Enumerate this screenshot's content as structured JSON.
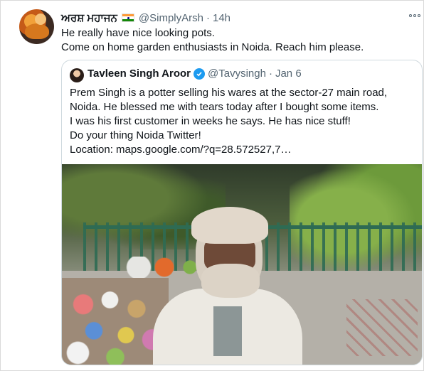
{
  "tweet": {
    "display_name": "ਅਰਸ਼ ਮਹਾਜਨ",
    "flag_icon": "india-flag",
    "handle": "@SimplyArsh",
    "separator": "·",
    "time": "14h",
    "text_lines": [
      "He really have nice looking pots.",
      "Come on home garden enthusiasts in Noida. Reach him please."
    ]
  },
  "quoted_tweet": {
    "display_name": "Tavleen Singh Aroor",
    "verified": true,
    "handle": "@Tavysingh",
    "separator": "·",
    "time": "Jan 6",
    "text_lines": [
      "Prem Singh is a potter selling his wares at the sector-27 main road,",
      "Noida. He blessed me with tears today after I bought some items.",
      "I was his first customer in weeks he says. He has nice stuff!",
      "Do your thing Noida Twitter!",
      "Location: maps.google.com/?q=28.572527,7…"
    ]
  },
  "colors": {
    "accent": "#1d9bf0",
    "text": "#0f1419",
    "secondary_text": "#536471",
    "border": "#cfd9de"
  }
}
